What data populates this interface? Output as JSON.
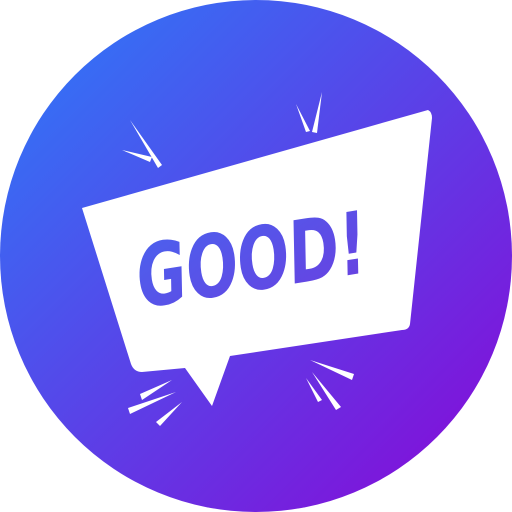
{
  "badge": {
    "text": "GOOD!"
  },
  "colors": {
    "gradient_start": "#2a7df9",
    "gradient_end": "#8a06d6",
    "bubble_fill": "#ffffff",
    "text_fill": "#5b4ae6",
    "burst_fill": "#ffffff"
  }
}
